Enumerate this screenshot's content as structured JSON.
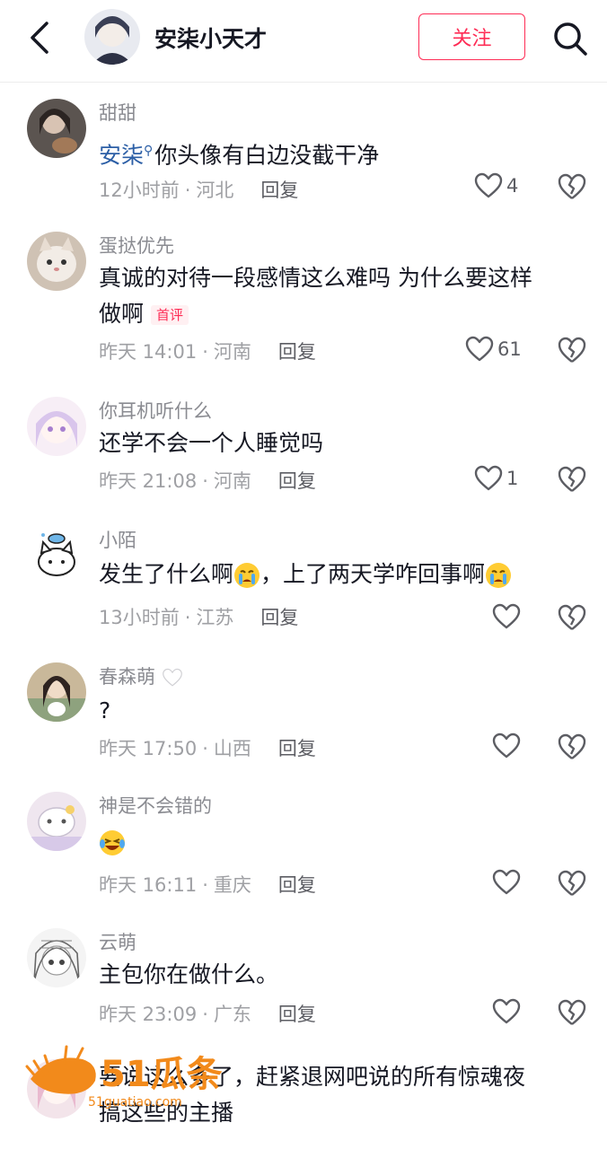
{
  "header": {
    "title": "安柒小天才",
    "follow_label": "关注"
  },
  "comments": [
    {
      "name": "甜甜",
      "mention": "安柒",
      "text": "你头像有白边没截干净",
      "time": "12小时前",
      "location": "河北",
      "reply": "回复",
      "likes": "4"
    },
    {
      "name": "蛋挞优先",
      "text_line1": "真诚的对待一段感情这么难吗 为什么要这样",
      "text_line2": "做啊",
      "badge": "首评",
      "time": "昨天 14:01",
      "location": "河南",
      "reply": "回复",
      "likes": "61"
    },
    {
      "name": "你耳机听什么",
      "text": "还学不会一个人睡觉吗",
      "time": "昨天 21:08",
      "location": "河南",
      "reply": "回复",
      "likes": "1"
    },
    {
      "name": "小陌",
      "text_a": "发生了什么啊",
      "text_b": "，上了两天学咋回事啊",
      "time": "13小时前",
      "location": "江苏",
      "reply": "回复",
      "likes": ""
    },
    {
      "name": "春森萌",
      "text": "?",
      "time": "昨天 17:50",
      "location": "山西",
      "reply": "回复",
      "likes": ""
    },
    {
      "name": "神是不会错的",
      "text": "",
      "time": "昨天 16:11",
      "location": "重庆",
      "reply": "回复",
      "likes": ""
    },
    {
      "name": "云萌",
      "text": "主包你在做什么。",
      "time": "昨天 23:09",
      "location": "广东",
      "reply": "回复",
      "likes": ""
    },
    {
      "name": "",
      "text_line1": "要说这么多了，赶紧退网吧说的所有惊魂夜",
      "text_line2": "搞这些的主播"
    }
  ],
  "watermark": {
    "brand": "51瓜条",
    "sub": "51guatiao.com"
  },
  "colors": {
    "accent": "#fe2c55",
    "mention": "#2c5fa6",
    "meta": "#9fa0a4"
  }
}
